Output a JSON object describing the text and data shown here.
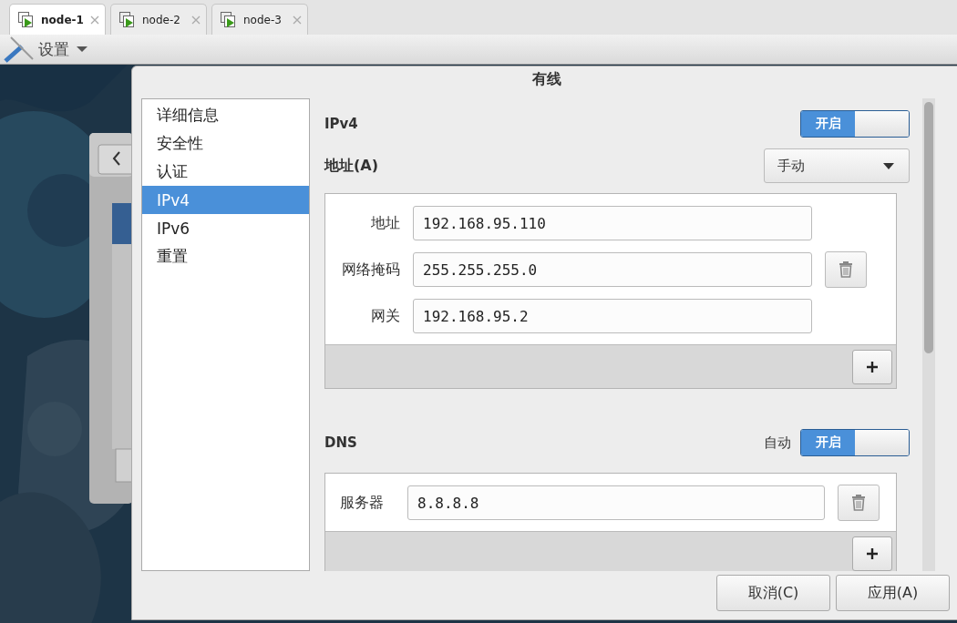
{
  "tabs": [
    {
      "label": "node-1",
      "selected": true
    },
    {
      "label": "node-2",
      "selected": false
    },
    {
      "label": "node-3",
      "selected": false
    }
  ],
  "toolbar": {
    "menu": "设置"
  },
  "dialog": {
    "title": "有线",
    "sidebar": {
      "items": [
        {
          "label": "详细信息",
          "selected": false
        },
        {
          "label": "安全性",
          "selected": false
        },
        {
          "label": "认证",
          "selected": false
        },
        {
          "label": "IPv4",
          "selected": true
        },
        {
          "label": "IPv6",
          "selected": false
        },
        {
          "label": "重置",
          "selected": false
        }
      ]
    },
    "ipv4": {
      "title": "IPv4",
      "switch": {
        "label": "开启",
        "on": true
      },
      "method_label": "地址(A)",
      "method": "手动",
      "fields": [
        {
          "label": "地址",
          "value": "192.168.95.110"
        },
        {
          "label": "网络掩码",
          "value": "255.255.255.0"
        },
        {
          "label": "网关",
          "value": "192.168.95.2"
        }
      ]
    },
    "dns": {
      "title": "DNS",
      "auto_label": "自动",
      "switch": {
        "label": "开启",
        "on": true
      },
      "servers": [
        {
          "label": "服务器",
          "value": "8.8.8.8"
        }
      ]
    },
    "buttons": [
      "取消(C)",
      "应用(A)"
    ]
  }
}
